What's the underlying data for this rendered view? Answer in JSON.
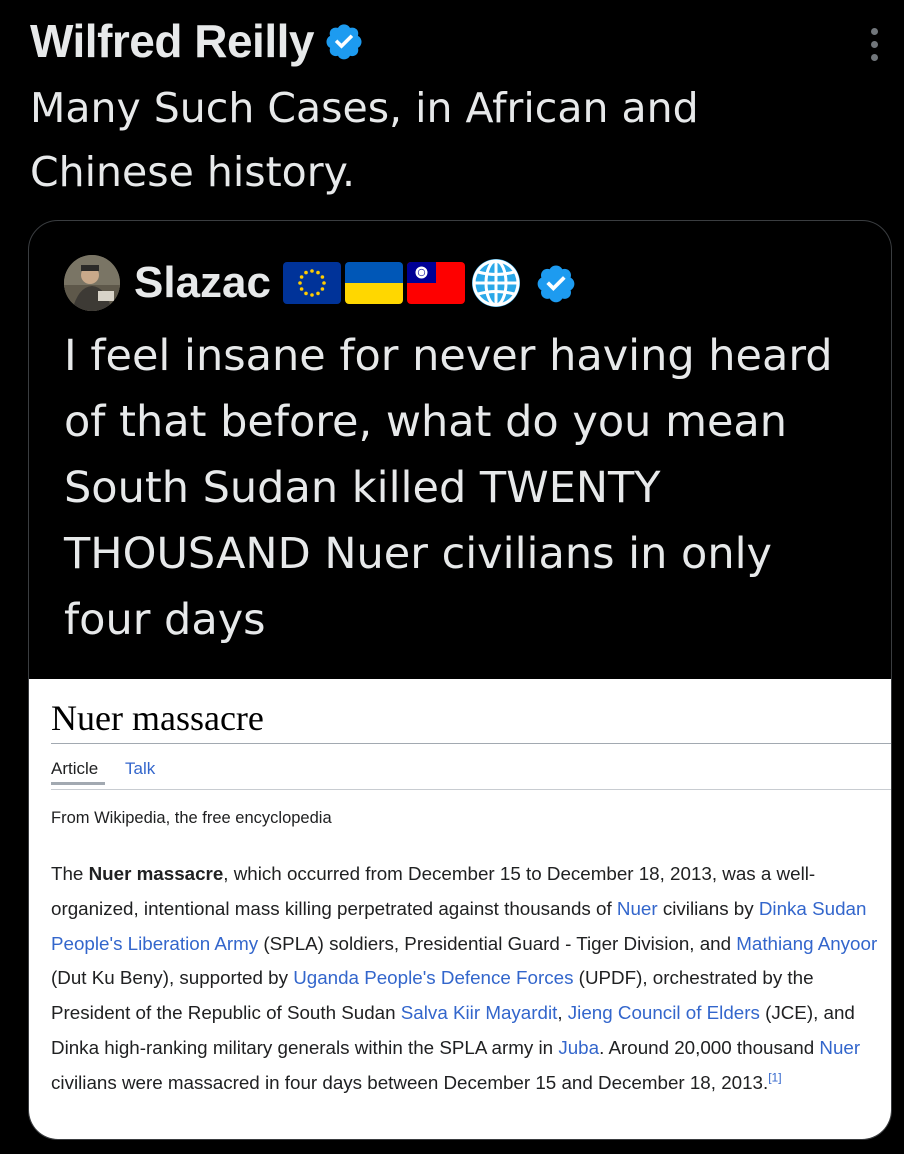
{
  "tweet": {
    "author_name": "Wilfred Reilly",
    "text": "Many Such Cases, in African and Chinese history."
  },
  "quote": {
    "author_name": "Slazac",
    "text": "I feel insane for never having heard of that before, what do you mean South Sudan killed TWENTY THOUSAND Nuer civilians in only four days",
    "flags": [
      "eu-flag-icon",
      "ukraine-flag-icon",
      "taiwan-flag-icon",
      "globe-icon"
    ]
  },
  "wiki": {
    "title": "Nuer massacre",
    "tab_article": "Article",
    "tab_talk": "Talk",
    "from": "From Wikipedia, the free encyclopedia",
    "p": {
      "s1": "The ",
      "bold1": "Nuer massacre",
      "s2": ", which occurred from December 15 to December 18, 2013, was a well-organized, intentional mass killing perpetrated against thousands of ",
      "l_nuer": "Nuer",
      "s3": " civilians by ",
      "l_dinka": "Dinka",
      "s4": " ",
      "l_spla": "Sudan People's Liberation Army",
      "s5": " (SPLA) soldiers, Presidential Guard - Tiger Division, and ",
      "l_mathiang": "Mathiang Anyoor",
      "s6": " (Dut Ku Beny), supported by ",
      "l_updf": "Uganda People's Defence Forces",
      "s7": " (UPDF), orchestrated by the President of the Republic of South Sudan ",
      "l_kiir": "Salva Kiir Mayardit",
      "s8": ", ",
      "l_jce": "Jieng Council of Elders",
      "s9": " (JCE), and Dinka high-ranking military generals within the SPLA army in ",
      "l_juba": "Juba",
      "s10": ". Around 20,000 thousand ",
      "l_nuer2": "Nuer",
      "s11": " civilians were massacred in four days between December 15 and December 18, 2013.",
      "ref": "[1]"
    }
  },
  "colors": {
    "background": "#000000",
    "text": "#e7e9ea",
    "verified_blue": "#1d9bf0",
    "link": "#3366cc"
  }
}
